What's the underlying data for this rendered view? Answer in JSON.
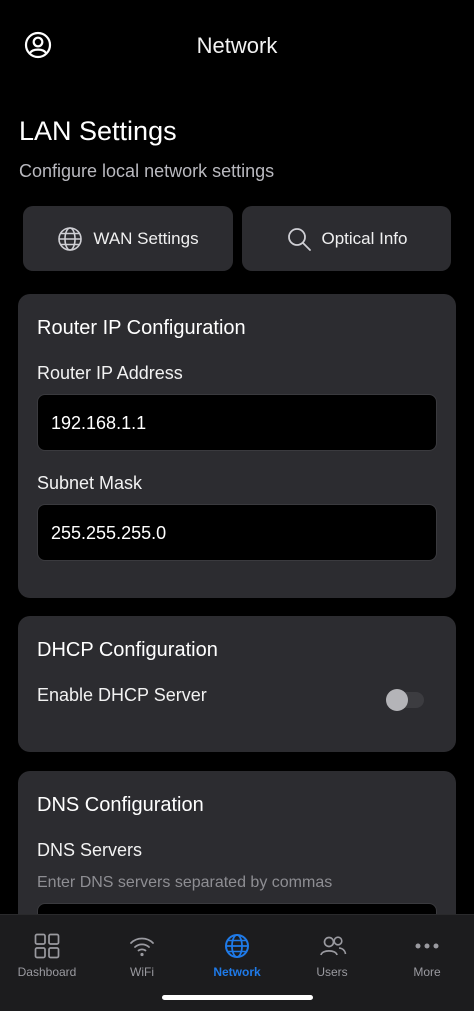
{
  "header": {
    "title": "Network",
    "profile_icon": "account-circle-icon"
  },
  "page": {
    "title": "LAN Settings",
    "subtitle": "Configure local network settings"
  },
  "quick_actions": [
    {
      "label": "WAN Settings",
      "icon": "globe-icon"
    },
    {
      "label": "Optical Info",
      "icon": "search-icon"
    }
  ],
  "router_ip": {
    "title": "Router IP Configuration",
    "ip_label": "Router IP Address",
    "ip_value": "192.168.1.1",
    "mask_label": "Subnet Mask",
    "mask_value": "255.255.255.0"
  },
  "dhcp": {
    "title": "DHCP Configuration",
    "enable_label": "Enable DHCP Server",
    "enabled": false
  },
  "dns": {
    "title": "DNS Configuration",
    "servers_label": "DNS Servers",
    "hint": "Enter DNS servers separated by commas"
  },
  "tabs": [
    {
      "label": "Dashboard",
      "icon": "grid-icon",
      "active": false
    },
    {
      "label": "WiFi",
      "icon": "wifi-icon",
      "active": false
    },
    {
      "label": "Network",
      "icon": "globe-icon",
      "active": true
    },
    {
      "label": "Users",
      "icon": "users-icon",
      "active": false
    },
    {
      "label": "More",
      "icon": "more-icon",
      "active": false
    }
  ],
  "colors": {
    "accent": "#1f7ae8",
    "card": "#2c2c30",
    "background": "#000000"
  }
}
